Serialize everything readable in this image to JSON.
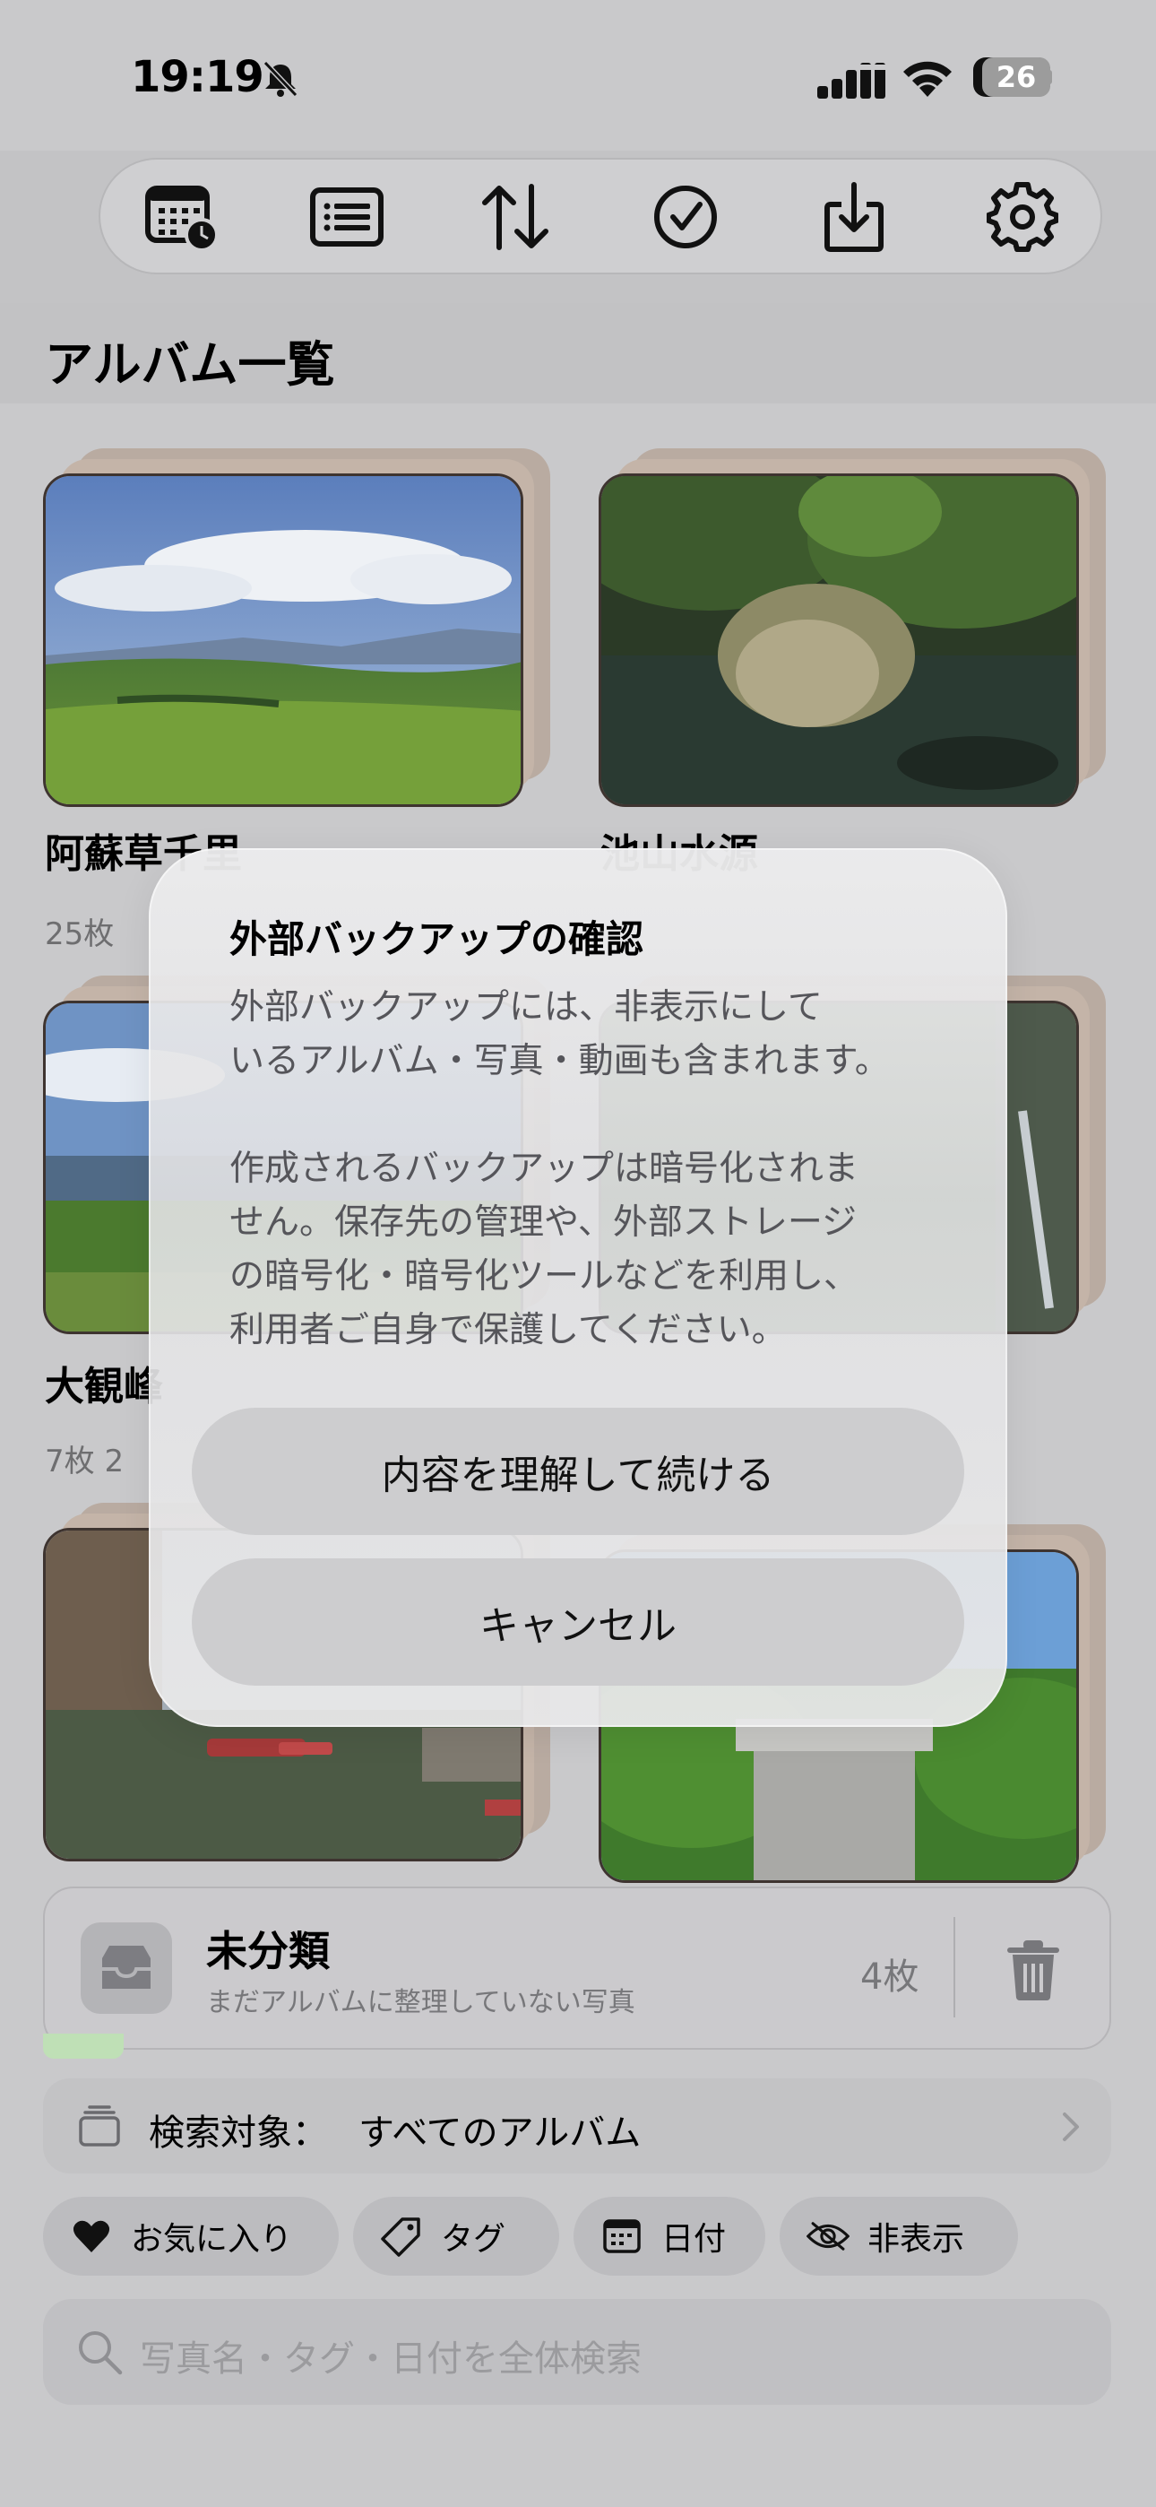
{
  "status_bar": {
    "time": "19:19",
    "battery": "26"
  },
  "toolbar": {
    "buttons": [
      {
        "name": "calendar-clock-icon"
      },
      {
        "name": "list-view-icon"
      },
      {
        "name": "sort-icon"
      },
      {
        "name": "select-checkmark-icon"
      },
      {
        "name": "import-download-icon"
      },
      {
        "name": "settings-gear-icon"
      }
    ]
  },
  "page": {
    "title": "アルバム一覧"
  },
  "albums": [
    {
      "name": "阿蘇草千里",
      "count": "25枚"
    },
    {
      "name": "池山水源",
      "count": ""
    },
    {
      "name": "大観峰",
      "count": "7枚  2"
    },
    {
      "name": "",
      "count": ""
    },
    {
      "name": "",
      "count": ""
    },
    {
      "name": "",
      "count": ""
    }
  ],
  "uncategorized": {
    "title": "未分類",
    "subtitle": "まだアルバムに整理していない写真",
    "count": "4枚"
  },
  "search_scope": {
    "label": "検索対象：",
    "value": "すべてのアルバム"
  },
  "filter_chips": [
    {
      "label": "お気に入り",
      "icon": "heart-icon"
    },
    {
      "label": "タグ",
      "icon": "tag-icon"
    },
    {
      "label": "日付",
      "icon": "calendar-icon"
    },
    {
      "label": "非表示",
      "icon": "eye-slash-icon"
    }
  ],
  "search": {
    "placeholder": "写真名・タグ・日付を全体検索"
  },
  "dialog": {
    "title": "外部バックアップの確認",
    "body": "外部バックアップには、非表示にして\nいるアルバム・写真・動画も含まれます。\n\n作成されるバックアップは暗号化されま\nせん。保存先の管理や、外部ストレージ\nの暗号化・暗号化ツールなどを利用し、\n利用者ご自身で保護してください。",
    "confirm_label": "内容を理解して続ける",
    "cancel_label": "キャンセル"
  }
}
